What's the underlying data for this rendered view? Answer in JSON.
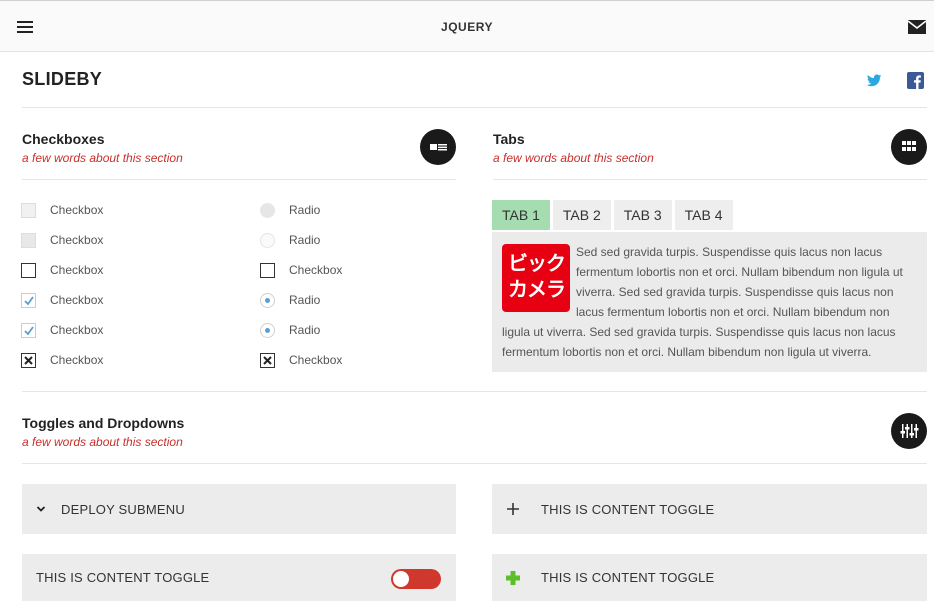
{
  "header": {
    "title": "JQUERY",
    "menu_icon": "hamburger-menu-icon",
    "mail_icon": "envelope-icon"
  },
  "brand": {
    "name": "SLIDEBY"
  },
  "social": {
    "twitter_icon": "twitter-bird-icon",
    "facebook_icon": "facebook-f-icon"
  },
  "checkboxes_section": {
    "title": "Checkboxes",
    "subtitle": "a few words about this section",
    "left_items": [
      {
        "label": "Checkbox",
        "state": "disabled"
      },
      {
        "label": "Checkbox",
        "state": "disabled-checked"
      },
      {
        "label": "Checkbox",
        "state": "unchecked"
      },
      {
        "label": "Checkbox",
        "state": "checked"
      },
      {
        "label": "Checkbox",
        "state": "checked"
      },
      {
        "label": "Checkbox",
        "state": "x-checked"
      }
    ],
    "right_items": [
      {
        "label": "Radio",
        "type": "radio",
        "state": "disabled"
      },
      {
        "label": "Radio",
        "type": "radio",
        "state": "disabled-light"
      },
      {
        "label": "Checkbox",
        "type": "checkbox",
        "state": "unchecked"
      },
      {
        "label": "Radio",
        "type": "radio",
        "state": "checked"
      },
      {
        "label": "Radio",
        "type": "radio",
        "state": "checked"
      },
      {
        "label": "Checkbox",
        "type": "checkbox",
        "state": "x-checked"
      }
    ]
  },
  "tabs_section": {
    "title": "Tabs",
    "subtitle": "a few words about this section",
    "tabs": [
      "TAB 1",
      "TAB 2",
      "TAB 3",
      "TAB 4"
    ],
    "active_tab": 0,
    "content": "Sed sed gravida turpis. Suspendisse quis lacus non lacus fermentum lobortis non et orci. Nullam bibendum non ligula ut viverra. Sed sed gravida turpis. Suspendisse quis lacus non lacus fermentum lobortis non et orci. Nullam bibendum non ligula ut viverra. Sed sed gravida turpis. Suspendisse quis lacus non lacus fermentum lobortis non et orci. Nullam bibendum non ligula ut viverra.",
    "logo_line1": "ビック",
    "logo_line2": "カメラ"
  },
  "toggles_section": {
    "title": "Toggles and Dropdowns",
    "subtitle": "a few words about this section",
    "deploy_label": "DEPLOY SUBMENU",
    "toggle_left_label": "THIS IS CONTENT TOGGLE",
    "toggle_right1_label": "THIS IS CONTENT TOGGLE",
    "toggle_right2_label": "THIS IS CONTENT TOGGLE",
    "switch_on": false
  },
  "colors": {
    "accent_red": "#c9302c",
    "tab_active": "#a5dcb0",
    "switch_red": "#d0382d",
    "plus_green": "#5cbf2a",
    "twitter_blue": "#2aa9e0",
    "facebook_blue": "#3b5998"
  }
}
